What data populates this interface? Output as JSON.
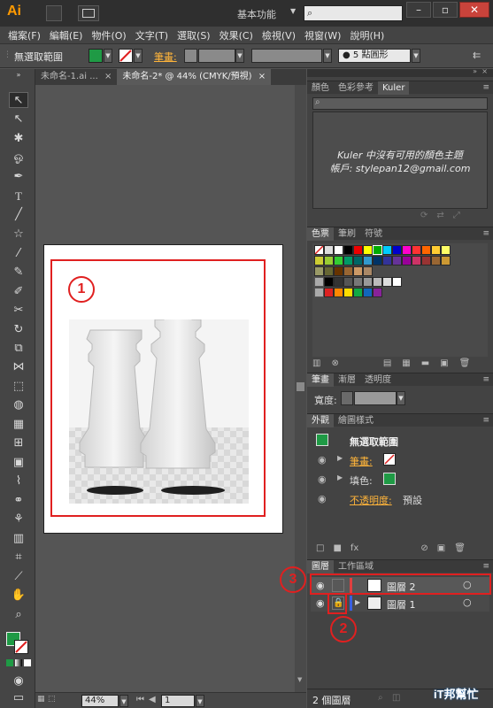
{
  "app": {
    "logo": "Ai",
    "workspace": "基本功能",
    "logo_color": "#ff9a00"
  },
  "menu": [
    "檔案(F)",
    "編輯(E)",
    "物件(O)",
    "文字(T)",
    "選取(S)",
    "效果(C)",
    "檢視(V)",
    "視窗(W)",
    "說明(H)"
  ],
  "control": {
    "selection_label": "無選取範圍",
    "stroke_label": "筆畫:",
    "brush_label": "5 點圓形"
  },
  "tabs": [
    "未命名-1.ai ...",
    "未命名-2* @ 44% (CMYK/預視)"
  ],
  "status": {
    "zoom": "44%",
    "page": "1"
  },
  "color_panel": {
    "tabs": [
      "顏色",
      "色彩參考",
      "Kuler"
    ],
    "message_line1": "Kuler 中沒有可用的顏色主題",
    "message_line2": "帳戶: stylepan12@gmail.com"
  },
  "swatch_panel": {
    "tabs": [
      "色票",
      "筆刷",
      "符號"
    ]
  },
  "stroke_panel": {
    "tabs": [
      "筆畫",
      "漸層",
      "透明度"
    ],
    "width_label": "寬度:"
  },
  "appearance_panel": {
    "tabs": [
      "外觀",
      "繪圖樣式"
    ],
    "title": "無選取範圍",
    "stroke_label": "筆畫:",
    "fill_label": "填色:",
    "opacity_label": "不透明度:",
    "opacity_value": "預設"
  },
  "layers_panel": {
    "tabs": [
      "圖層",
      "工作區域"
    ],
    "layers": [
      {
        "name": "圖層 2",
        "locked": false
      },
      {
        "name": "圖層 1",
        "locked": true
      }
    ],
    "footer": "2 個圖層"
  },
  "annotations": [
    "1",
    "2",
    "3"
  ],
  "watermark": {
    "text": "iT邦幫忙"
  }
}
